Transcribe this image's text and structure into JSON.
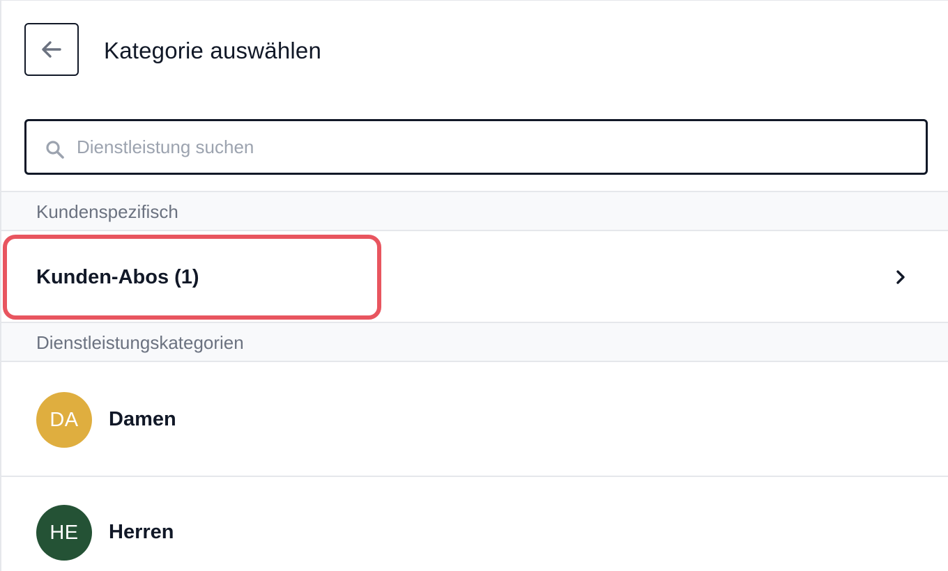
{
  "header": {
    "title": "Kategorie auswählen",
    "back_icon": "arrow-left-icon"
  },
  "search": {
    "placeholder": "Dienstleistung suchen",
    "value": "",
    "icon": "search-icon"
  },
  "sections": [
    {
      "title": "Kundenspezifisch",
      "items": [
        {
          "label": "Kunden-Abos (1)",
          "icon": "chevron-right-icon",
          "highlighted": true
        }
      ]
    },
    {
      "title": "Dienstleistungskategorien",
      "items": [
        {
          "label": "Damen",
          "initials": "DA",
          "avatar_color": "#DFAE3F"
        },
        {
          "label": "Herren",
          "initials": "HE",
          "avatar_color": "#245235"
        }
      ]
    }
  ],
  "colors": {
    "highlight": "#E8555F",
    "text_primary": "#111827",
    "text_muted": "#6B7280",
    "placeholder": "#9CA3AF",
    "section_bg": "#F8F9FB",
    "divider": "#E5E7EB"
  }
}
